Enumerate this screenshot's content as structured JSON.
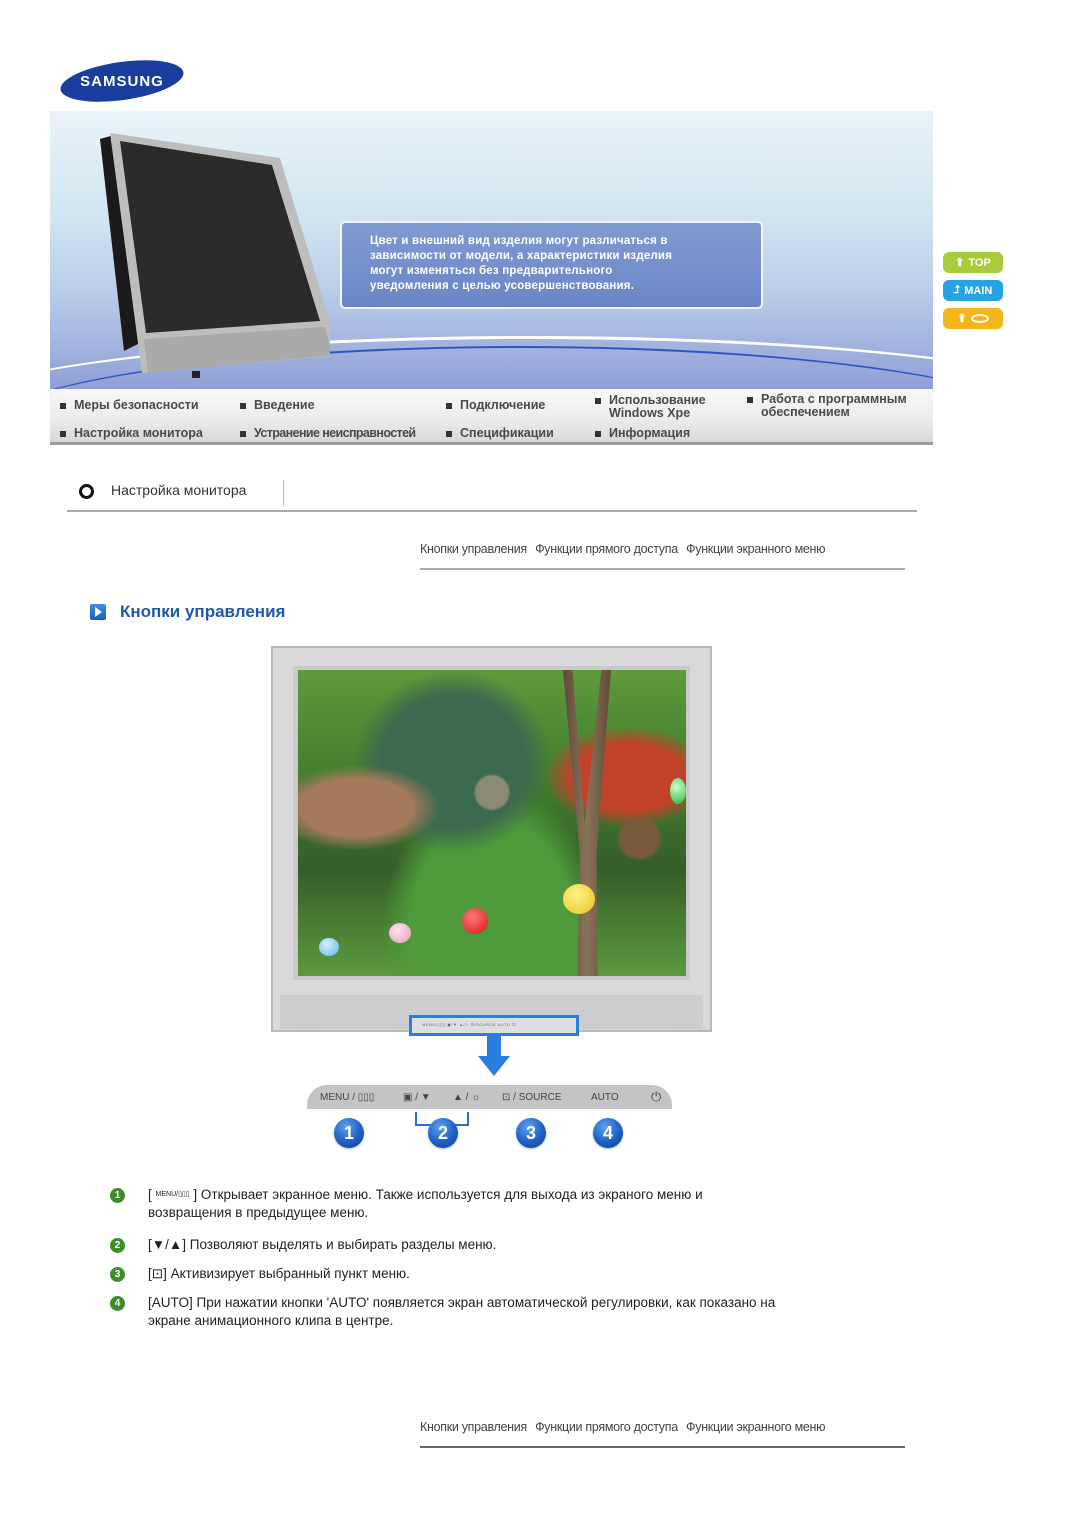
{
  "brand": {
    "logo_text": "SAMSUNG"
  },
  "banner": {
    "notice_lines": [
      "Цвет и внешний вид изделия могут различаться в",
      "зависимости от модели, а характеристики изделия",
      "могут изменяться без предварительного",
      "уведомления с целью усовершенствования."
    ]
  },
  "side_buttons": [
    {
      "label": "TOP",
      "icon": "arrow-up-icon",
      "color": "#a8cc3c"
    },
    {
      "label": "MAIN",
      "icon": "arrow-turn-icon",
      "color": "#27a3e3"
    },
    {
      "label": "",
      "icon": "arrow-up-disc-icon",
      "color": "#f6b51a"
    }
  ],
  "nav": {
    "items": [
      {
        "label": "Меры безопасности"
      },
      {
        "label": "Введение"
      },
      {
        "label": "Подключение"
      },
      {
        "label": "Использование Windows Xpe",
        "line1": "Использование",
        "line2": "Windows Xpe"
      },
      {
        "label": "Работа с программным обеспечением",
        "line1": "Работа с программным",
        "line2": "обеспечением"
      },
      {
        "label": "Настройка монитора"
      },
      {
        "label": "Устранение неисправностей"
      },
      {
        "label": "Спецификации"
      },
      {
        "label": "Информация"
      }
    ]
  },
  "section": {
    "title": "Настройка монитора"
  },
  "subnav": {
    "items": [
      "Кнопки управления",
      "Функции прямого доступа",
      "Функции экранного меню"
    ]
  },
  "heading": "Кнопки управления",
  "control_panel": {
    "mini_label": "MENU/▯▯▯  ▣/▼  ▲/✧  ⊡/SOURCE  AUTO  ⏻",
    "labels": [
      "MENU / ▯▯▯",
      "▣ / ▼",
      "▲ / ☼",
      "⊡ / SOURCE",
      "AUTO",
      "⏻"
    ],
    "numbers": [
      "1",
      "2",
      "3",
      "4"
    ]
  },
  "descriptions": [
    {
      "num": "1",
      "key": "MENU/▯▯▯",
      "text": "] Открывает экранное меню. Также используется для выхода из экраного меню и возвращения в предыдущее меню."
    },
    {
      "num": "2",
      "key": "▼/▲",
      "text": "] Позволяют выделять и выбирать разделы меню."
    },
    {
      "num": "3",
      "key": "⊡",
      "text": "] Активизирует выбранный пункт меню."
    },
    {
      "num": "4",
      "key": "AUTO",
      "text": "] При нажатии кнопки 'AUTO' появляется экран автоматической регулировки, как показано на экране анимационного клипа в центре."
    }
  ]
}
